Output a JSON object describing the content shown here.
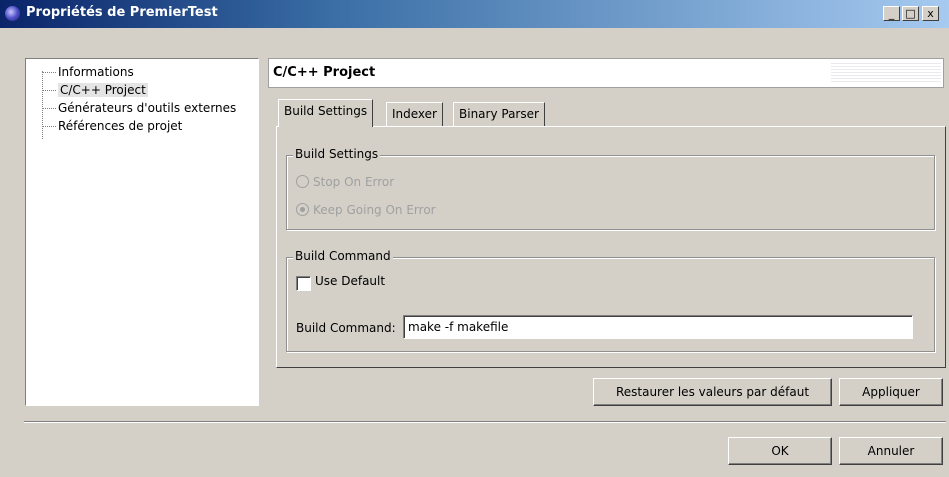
{
  "window": {
    "title": "Propriétés de PremierTest",
    "minimize": "_",
    "maximize": "□",
    "close": "x"
  },
  "tree": {
    "items": [
      {
        "label": "Informations"
      },
      {
        "label": "C/C++ Project"
      },
      {
        "label": "Générateurs d'outils externes"
      },
      {
        "label": "Références de projet"
      }
    ],
    "selected": "C/C++ Project"
  },
  "header": {
    "title": "C/C++ Project"
  },
  "tabs": [
    {
      "label": "Build Settings"
    },
    {
      "label": "Indexer"
    },
    {
      "label": "Binary Parser"
    }
  ],
  "build_settings_group": {
    "legend": "Build Settings",
    "options": [
      {
        "label": "Stop On Error",
        "checked": false
      },
      {
        "label": "Keep Going On Error",
        "checked": true
      }
    ]
  },
  "build_command_group": {
    "legend": "Build Command",
    "use_default_label": "Use Default",
    "use_default_checked": false,
    "field_label": "Build Command:",
    "field_value": "make -f makefile"
  },
  "buttons": {
    "restore_defaults": "Restaurer les valeurs par défaut",
    "apply": "Appliquer",
    "ok": "OK",
    "cancel": "Annuler"
  }
}
